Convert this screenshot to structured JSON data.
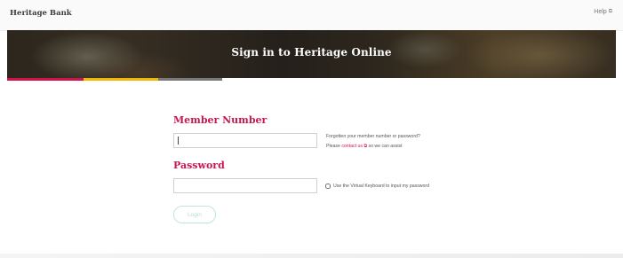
{
  "header": {
    "brand": "Heritage Bank",
    "help_label": "Help",
    "help_icon": "external-link-icon"
  },
  "banner": {
    "title": "Sign in to Heritage Online",
    "stripe_colors": [
      "#d2134b",
      "#f2b705",
      "#7a7a7a"
    ]
  },
  "form": {
    "member_label": "Member Number",
    "member_value": "",
    "member_placeholder": "",
    "forgot_line1": "Forgotten your member number or password?",
    "forgot_line2_prefix": "Please",
    "contact_link": "contact us",
    "forgot_line2_suffix": "so we can assist",
    "password_label": "Password",
    "password_value": "",
    "virtual_keyboard_label": "Use the Virtual Keyboard to input my password",
    "virtual_keyboard_checked": false,
    "login_label": "Login"
  },
  "colors": {
    "accent": "#c8184f",
    "login_button": "#b7ded4"
  }
}
